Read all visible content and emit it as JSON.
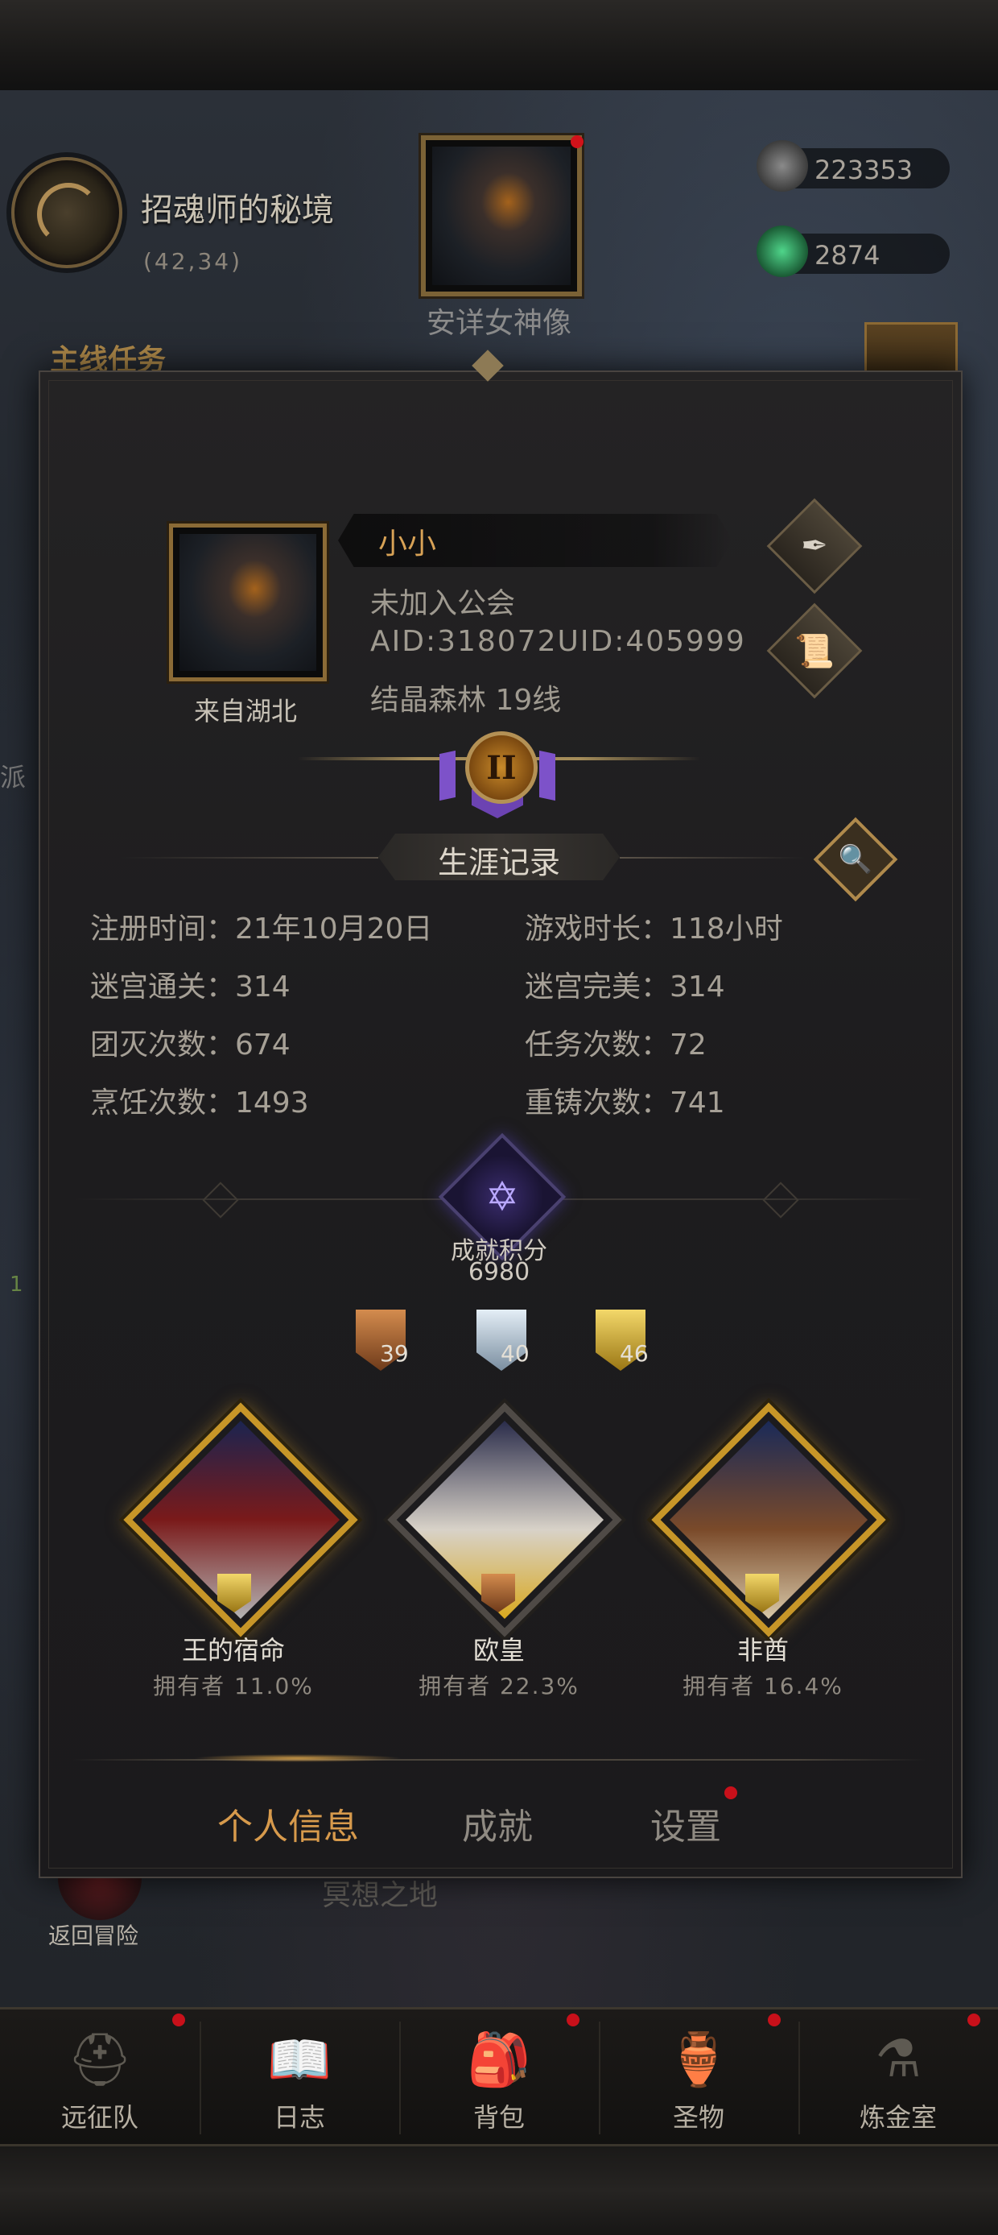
{
  "hud": {
    "location_name": "招魂师的秘境",
    "coordinates": "(42,34)",
    "shrine_label": "安详女神像",
    "quest_label": "主线任务",
    "side_text_1": "派",
    "side_text_2": "1",
    "resources": [
      {
        "icon": "stone-icon",
        "value": "223353",
        "color": "#6b6b6b"
      },
      {
        "icon": "emerald-icon",
        "value": "2874",
        "color": "#2f9a5c"
      }
    ]
  },
  "profile": {
    "player_name": "小小",
    "guild": "未加入公会",
    "ids": "AID:318072UID:405999",
    "server": "结晶森林  19线",
    "origin": "来自湖北",
    "rank_numeral": "II"
  },
  "career": {
    "title": "生涯记录",
    "stats": [
      {
        "label": "注册时间：21年10月20日"
      },
      {
        "label": "游戏时长：118小时"
      },
      {
        "label": "迷宫通关：314"
      },
      {
        "label": "迷宫完美：314"
      },
      {
        "label": "团灭次数：674"
      },
      {
        "label": "任务次数：72"
      },
      {
        "label": "烹饪次数：1493"
      },
      {
        "label": "重铸次数：741"
      }
    ]
  },
  "achievement": {
    "label": "成就积分",
    "score": "6980",
    "medals": [
      {
        "tier": "bronze",
        "count": "39",
        "color": "#b06a3a"
      },
      {
        "tier": "silver",
        "count": "40",
        "color": "#9fb4c6"
      },
      {
        "tier": "gold",
        "count": "46",
        "color": "#d7b53a"
      }
    ],
    "titles": [
      {
        "name": "王的宿命",
        "owners": "拥有者  11.0%"
      },
      {
        "name": "欧皇",
        "owners": "拥有者  22.3%"
      },
      {
        "name": "非酋",
        "owners": "拥有者  16.4%"
      }
    ]
  },
  "tabs": {
    "items": [
      "个人信息",
      "成就",
      "设置"
    ],
    "active": "个人信息"
  },
  "behind": {
    "place_text": "冥想之地",
    "return_label": "返回冒险"
  },
  "nav": {
    "items": [
      {
        "label": "远征队",
        "icon": "helmet-icon"
      },
      {
        "label": "日志",
        "icon": "journal-icon"
      },
      {
        "label": "背包",
        "icon": "backpack-icon"
      },
      {
        "label": "圣物",
        "icon": "brazier-icon"
      },
      {
        "label": "炼金室",
        "icon": "alchemy-icon"
      }
    ]
  }
}
